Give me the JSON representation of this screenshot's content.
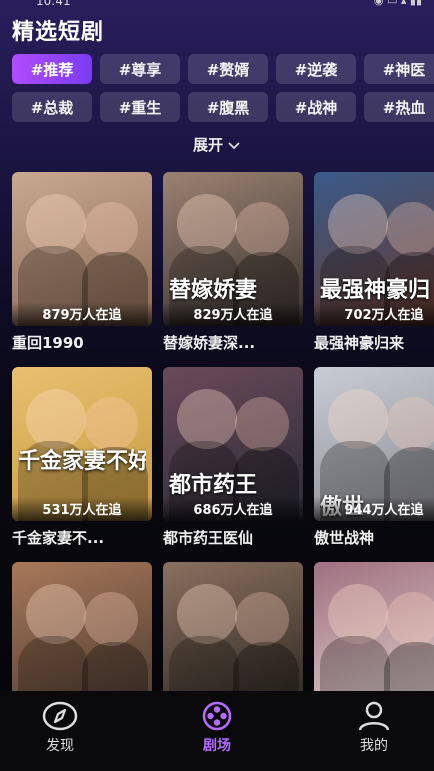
{
  "status": {
    "time": "10:41",
    "icons": "◉ ▭ ▴ ▮▮"
  },
  "page": {
    "title": "精选短剧",
    "expand_label": "展开"
  },
  "tags": [
    [
      "#推荐",
      "#尊享",
      "#赘婿",
      "#逆袭",
      "#神医"
    ],
    [
      "#总裁",
      "#重生",
      "#腹黑",
      "#战神",
      "#热血"
    ]
  ],
  "active_tag": "#推荐",
  "dramas": [
    {
      "title": "重回1990",
      "views": "879万人在追",
      "overlay": "",
      "colors": [
        "#8a6a55",
        "#c9a890"
      ]
    },
    {
      "title": "替嫁娇妻深...",
      "views": "829万人在追",
      "overlay": "替嫁娇妻",
      "colors": [
        "#3a3230",
        "#9a8272"
      ]
    },
    {
      "title": "最强神豪归来",
      "views": "702万人在追",
      "overlay": "最强神豪归",
      "colors": [
        "#6a3a2a",
        "#3a5a8a"
      ]
    },
    {
      "title": "千金家妻不...",
      "views": "531万人在追",
      "overlay": "千金家妻不好惹",
      "colors": [
        "#c89a40",
        "#e8c070"
      ]
    },
    {
      "title": "都市药王医仙",
      "views": "686万人在追",
      "overlay": "都市药王",
      "colors": [
        "#2a2a35",
        "#6a4a5a"
      ]
    },
    {
      "title": "傲世战神",
      "views": "944万人在追",
      "overlay": "傲世",
      "colors": [
        "#8a8a90",
        "#c8ccd4"
      ]
    },
    {
      "title": "",
      "views": "",
      "overlay": "",
      "colors": [
        "#4a3a30",
        "#a8785a"
      ]
    },
    {
      "title": "",
      "views": "",
      "overlay": "",
      "colors": [
        "#2a2620",
        "#8a7060"
      ]
    },
    {
      "title": "",
      "views": "",
      "overlay": "",
      "colors": [
        "#e0d4d0",
        "#a07080"
      ]
    }
  ],
  "nav": [
    {
      "label": "发现",
      "icon": "compass-icon",
      "active": false
    },
    {
      "label": "剧场",
      "icon": "film-reel-icon",
      "active": true
    },
    {
      "label": "我的",
      "icon": "user-icon",
      "active": false
    }
  ],
  "colors": {
    "accent": "#b04cff",
    "nav_active": "#b56cff"
  }
}
